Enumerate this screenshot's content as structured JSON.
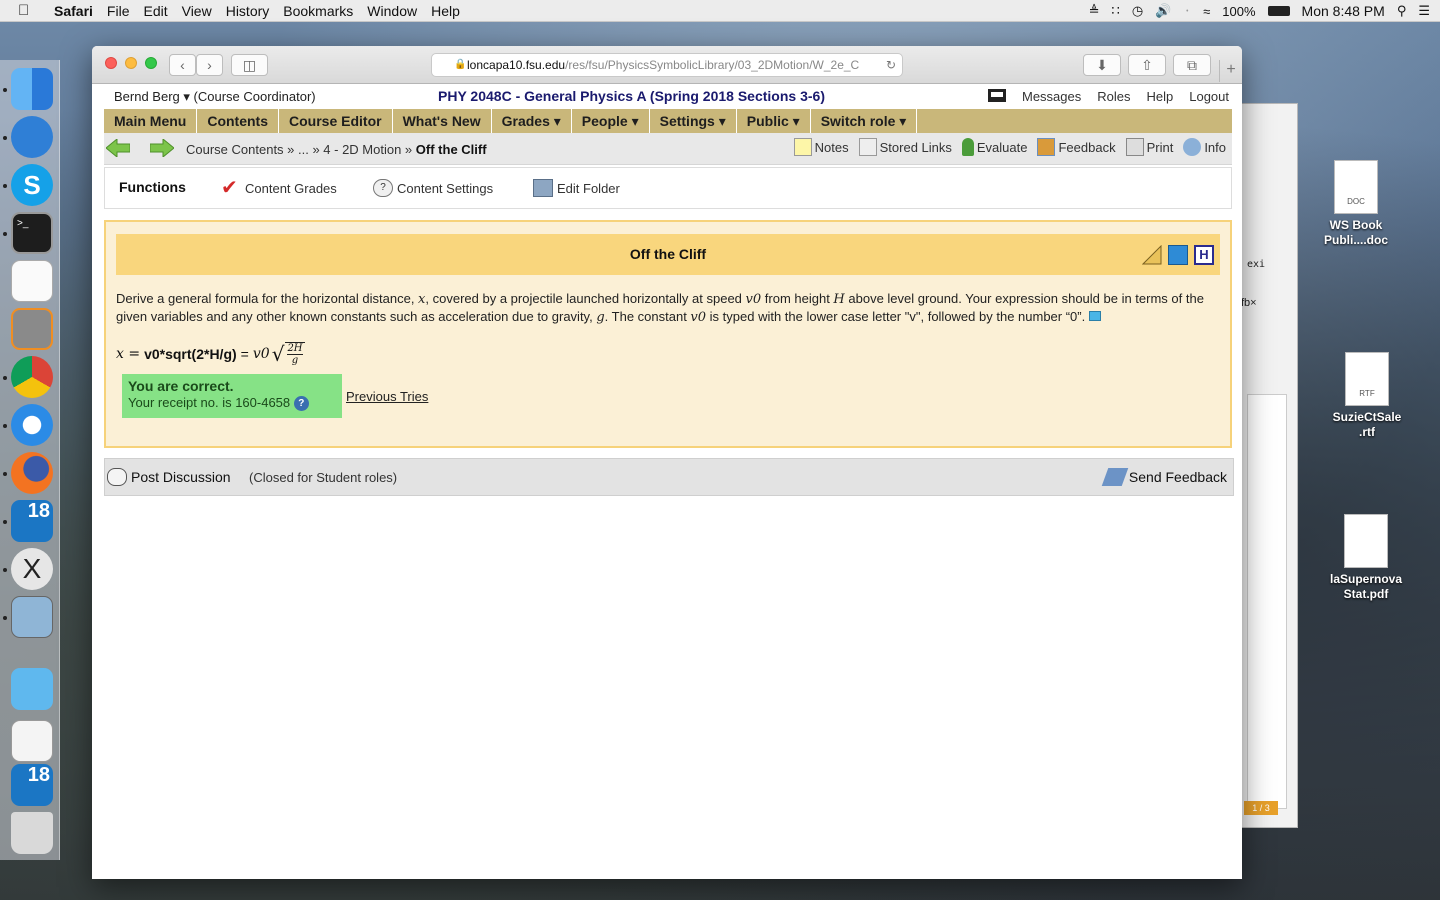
{
  "menubar": {
    "app": "Safari",
    "items": [
      "File",
      "Edit",
      "View",
      "History",
      "Bookmarks",
      "Window",
      "Help"
    ],
    "battery": "100%",
    "clock": "Mon 8:48 PM"
  },
  "desktop": {
    "icons": [
      {
        "name": "WS Book Publi....doc",
        "label_line1": "WS Book",
        "label_line2": "Publi....doc",
        "badge": "DOC"
      },
      {
        "name": "SuzieCtSale.rtf",
        "label_line1": "SuzieCtSale",
        "label_line2": ".rtf",
        "badge": "RTF"
      },
      {
        "name": "laSupernova Stat.pdf",
        "label_line1": "laSupernova",
        "label_line2": "Stat.pdf",
        "badge": ""
      }
    ],
    "bg_window": {
      "text1": "exi",
      "text2": "fb×",
      "page_badge": "1 / 3"
    }
  },
  "browser": {
    "url_host": "loncapa10.fsu.edu",
    "url_path": "/res/fsu/PhysicsSymbolicLibrary/03_2DMotion/W_2e_C"
  },
  "header": {
    "user": "Bernd Berg",
    "role": "(Course Coordinator)",
    "course": "PHY 2048C - General Physics A (Spring 2018 Sections 3-6)",
    "links": [
      "Messages",
      "Roles",
      "Help",
      "Logout"
    ]
  },
  "mainmenu": [
    {
      "label": "Main Menu"
    },
    {
      "label": "Contents"
    },
    {
      "label": "Course Editor"
    },
    {
      "label": "What's New"
    },
    {
      "label": "Grades ▾"
    },
    {
      "label": "People ▾"
    },
    {
      "label": "Settings ▾"
    },
    {
      "label": "Public ▾"
    },
    {
      "label": "Switch role ▾"
    }
  ],
  "breadcrumb": {
    "part1": "Course Contents » ... » 4 - 2D Motion »",
    "current": "Off the Cliff"
  },
  "tools": [
    "Notes",
    "Stored Links",
    "Evaluate",
    "Feedback",
    "Print",
    "Info"
  ],
  "functions": {
    "title": "Functions",
    "items": [
      "Content Grades",
      "Content Settings",
      "Edit Folder"
    ]
  },
  "problem": {
    "title": "Off the Cliff",
    "text_a": "Derive a general formula for the horizontal distance, ",
    "var_x": "x",
    "text_b": ", covered by a projectile launched horizontally at speed ",
    "var_v0": "v0",
    "text_c": " from height ",
    "var_H": "H",
    "text_d": " above level ground. Your expression should be in terms of the given variables and any other known constants such as acceleration due to gravity, ",
    "var_g": "g",
    "text_e": ". The constant ",
    "var_v0b": "v0",
    "text_f": " is typed with the lower case letter \"v\", followed by the number “0”.",
    "answer_lhs": "x =",
    "answer_typed": "v0*sqrt(2*H/g)",
    "answer_eq": "=",
    "answer_v0": "v0",
    "frac_num": "2H",
    "frac_den": "g",
    "correct_title": "You are correct.",
    "receipt": "Your receipt no. is 160-4658",
    "previous_tries": "Previous Tries"
  },
  "discussion": {
    "post": "Post Discussion",
    "closed": "(Closed for Student roles)",
    "send_feedback": "Send Feedback"
  }
}
